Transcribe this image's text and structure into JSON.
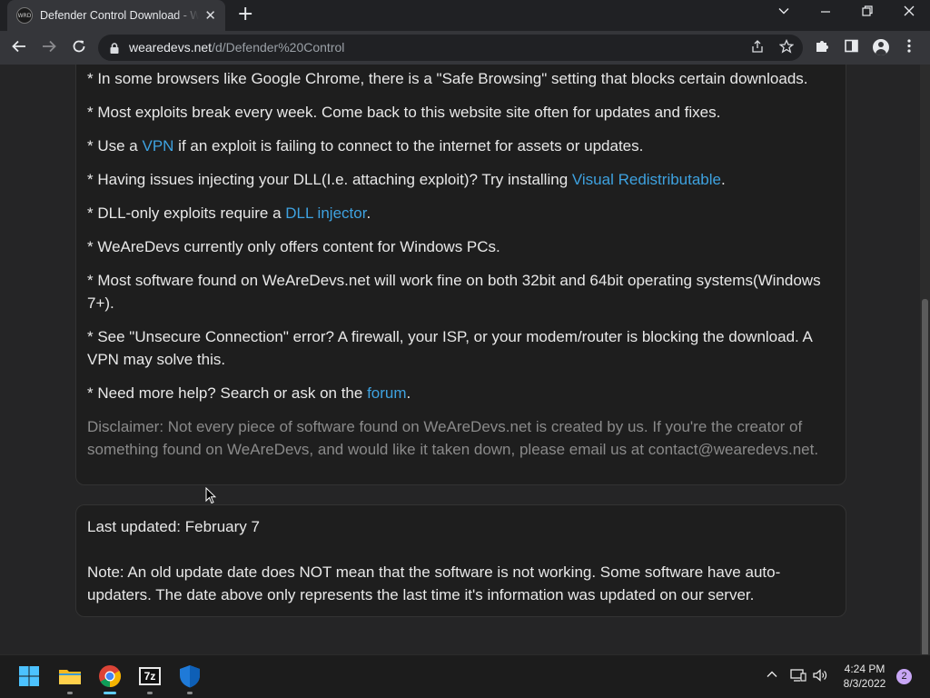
{
  "browser": {
    "tab_title": "Defender Control Download - WeAreDevs",
    "favicon_text": "WRD",
    "url_host": "wearedevs.net",
    "url_path": "/d/Defender%20Control"
  },
  "card1": {
    "lines": [
      "* In some browsers like Google Chrome, there is a \"Safe Browsing\" setting that blocks certain downloads.",
      "* Most exploits break every week. Come back to this website site often for updates and fixes."
    ],
    "vpn": {
      "before": "* Use a ",
      "link": "VPN",
      "after": " if an exploit is failing to connect to the internet for assets or updates."
    },
    "dll_issue": {
      "before": "* Having issues injecting your DLL(I.e. attaching exploit)? Try installing ",
      "link": "Visual Redistributable",
      "after": "."
    },
    "dll_only": {
      "before": "* DLL-only exploits require a ",
      "link": "DLL injector",
      "after": "."
    },
    "windows": "* WeAreDevs currently only offers content for Windows PCs.",
    "bits": "* Most software found on WeAreDevs.net will work fine on both 32bit and 64bit operating systems(Windows 7+).",
    "unsecure": "* See \"Unsecure Connection\" error? A firewall, your ISP, or your modem/router is blocking the download. A VPN may solve this.",
    "help": {
      "before": "* Need more help? Search or ask on the ",
      "link": "forum",
      "after": "."
    },
    "disclaimer": "Disclaimer: Not every piece of software found on WeAreDevs.net is created by us. If you're the creator of something found on WeAreDevs, and would like it taken down, please email us at contact@wearedevs.net."
  },
  "card2": {
    "updated": "Last updated: February 7",
    "note": "Note: An old update date does NOT mean that the software is not working. Some software have auto-updaters. The date above only represents the last time it's information was updated on our server."
  },
  "taskbar": {
    "time": "4:24 PM",
    "date": "8/3/2022",
    "notification_count": "2",
    "app_7zip_label": "7z"
  },
  "icons": {
    "back": "back-arrow-icon",
    "forward": "forward-arrow-icon",
    "reload": "reload-icon",
    "lock": "lock-icon",
    "share": "share-icon",
    "star": "bookmark-star-icon",
    "extensions": "puzzle-icon",
    "sidepanel": "side-panel-icon",
    "profile": "profile-icon",
    "menu": "kebab-menu-icon",
    "start": "windows-start-icon",
    "explorer": "folder-icon",
    "chrome": "chrome-icon",
    "sevenzip": "7zip-icon",
    "defender": "shield-icon",
    "chevron": "chevron-up-icon",
    "network": "network-icon",
    "volume": "speaker-icon"
  },
  "colors": {
    "link": "#3ea2e0",
    "card_bg": "#1e1e1e",
    "page_bg": "#252526",
    "chrome_toolbar": "#35363a"
  }
}
